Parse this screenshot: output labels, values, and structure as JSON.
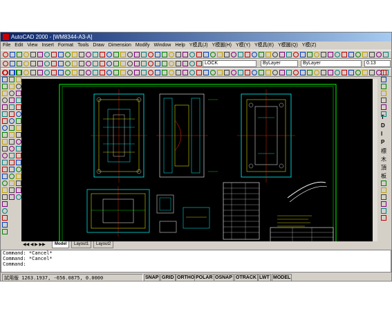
{
  "window": {
    "title": "AutoCAD 2000 - [WM8344-A3-A]"
  },
  "menu": [
    "File",
    "Edit",
    "View",
    "Insert",
    "Format",
    "Tools",
    "Draw",
    "Dimension",
    "Modify",
    "Window",
    "Help",
    "Y模具(J)",
    "Y模圖(H)",
    "Y模(Y)",
    "Y模具(E)",
    "Y模圖(Q)",
    "Y模(Z)"
  ],
  "toolbar": {
    "layer_value": "LOCK",
    "color_value": "ByLayer",
    "linetype_value": "ByLayer",
    "lineweight_value": "0.13"
  },
  "right_toolbar": {
    "letters": [
      "T",
      "D",
      "I",
      "P",
      "標",
      "木",
      "頂",
      "板"
    ]
  },
  "layout_tabs": [
    "Model",
    "Layout1",
    "Layout2"
  ],
  "command_lines": [
    "Command: *Cancel*",
    "Command: *Cancel*",
    "Command:"
  ],
  "status": {
    "prefix": "試用版",
    "coords": "1263.1937, -656.0875, 0.0000",
    "buttons": [
      "SNAP",
      "GRID",
      "ORTHO",
      "POLAR",
      "OSNAP",
      "OTRACK",
      "LWT",
      "MODEL"
    ]
  },
  "colors": {
    "canvas": "#000000",
    "border": "#00ff00",
    "lines_a": "#00ffff",
    "lines_b": "#ffff00",
    "lines_c": "#ff3300",
    "lines_d": "#ffffff"
  }
}
